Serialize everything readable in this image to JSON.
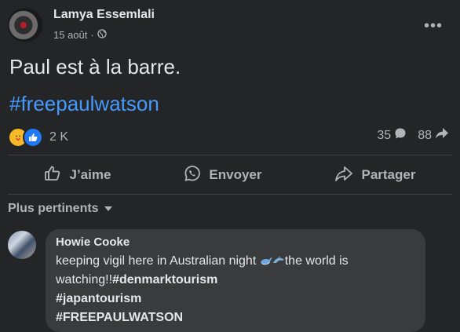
{
  "post": {
    "author": "Lamya Essemlali",
    "date": "15 août",
    "separator": "·",
    "text": "Paul est à la barre.",
    "hashtag": "#freepaulwatson",
    "more_label": "•••"
  },
  "reactions": {
    "count": "2 K",
    "icons": [
      "care-icon",
      "like-icon"
    ]
  },
  "stats": {
    "comments": "35",
    "shares": "88"
  },
  "actions": {
    "like": "J’aime",
    "send": "Envoyer",
    "share": "Partager"
  },
  "comments": {
    "sort_label": "Plus pertinents",
    "items": [
      {
        "author": "Howie Cooke",
        "text_part1": "keeping vigil here in Australian night ",
        "text_part2": "the world is watching!!",
        "tag1": "#denmarktourism",
        "tag2": "#japantourism",
        "tag3": "#FREEPAULWATSON"
      }
    ]
  },
  "colors": {
    "background": "#242526",
    "text": "#e4e6eb",
    "muted": "#b0b3b8",
    "link": "#4599ff",
    "bubble": "#3a3b3c"
  }
}
